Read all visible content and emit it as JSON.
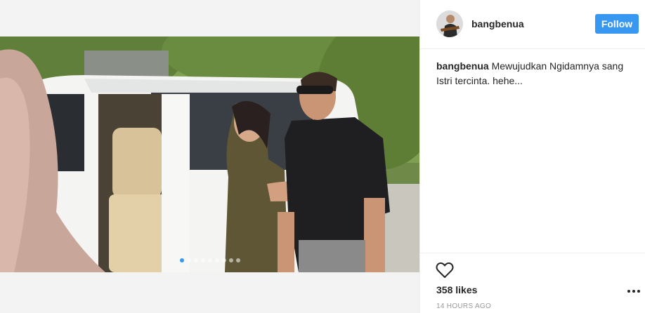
{
  "post": {
    "username": "bangbenua",
    "follow_label": "Follow",
    "caption_user": "bangbenua",
    "caption_text": "Mewujudkan Ngidamnya sang Istri tercinta. hehe...",
    "likes": "358 likes",
    "timestamp": "14 HOURS AGO",
    "carousel": {
      "total_slides": 9,
      "active_index": 0
    }
  },
  "icons": {
    "heart": "heart-outline-icon",
    "more": "more-options-icon"
  },
  "colors": {
    "accent": "#3897f0",
    "text": "#262626",
    "muted": "#999999"
  }
}
